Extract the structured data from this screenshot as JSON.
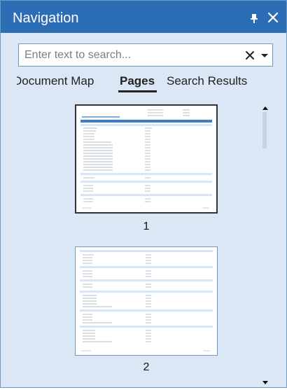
{
  "pane": {
    "title": "Navigation",
    "icons": {
      "pin": "pin-icon",
      "close": "close-icon"
    }
  },
  "search": {
    "placeholder": "Enter text to search...",
    "value": "",
    "icons": {
      "clear": "close-icon",
      "options": "dropdown-arrow-icon"
    }
  },
  "tabs": [
    {
      "label": "Document Map",
      "selected": false
    },
    {
      "label": "Pages",
      "selected": true
    },
    {
      "label": "Search Results",
      "selected": false
    }
  ],
  "pages": [
    {
      "number": "1",
      "selected": true
    },
    {
      "number": "2",
      "selected": false
    }
  ],
  "colors": {
    "titlebar": "#2b6eb5",
    "pane_background": "#dbe7f5",
    "border": "#6f98c4"
  }
}
